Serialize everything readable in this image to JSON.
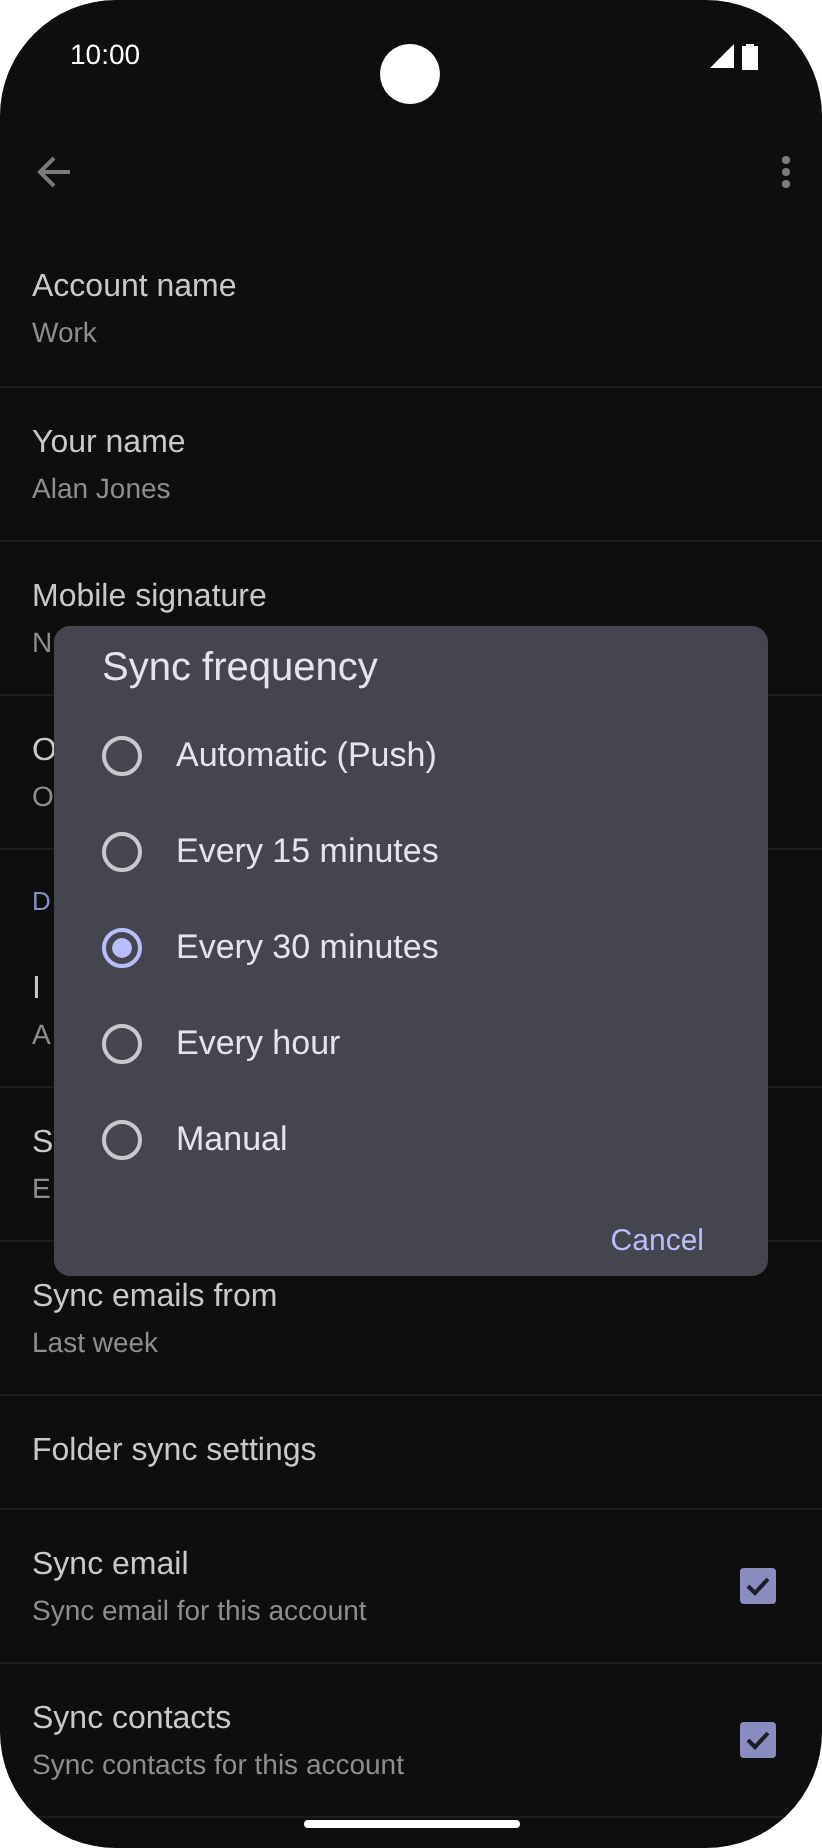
{
  "status_bar": {
    "time": "10:00"
  },
  "rows": [
    {
      "kind": "setting",
      "title": "Account name",
      "subtitle": "Work"
    },
    {
      "kind": "setting",
      "title": "Your name",
      "subtitle": "Alan Jones"
    },
    {
      "kind": "setting",
      "title": "Mobile signature",
      "subtitle": "N"
    },
    {
      "kind": "setting",
      "title": "O",
      "subtitle": "O"
    },
    {
      "kind": "header",
      "title": "D"
    },
    {
      "kind": "setting",
      "title": "I",
      "subtitle": "A"
    },
    {
      "kind": "setting",
      "title": "S",
      "subtitle": "E"
    },
    {
      "kind": "setting",
      "title": "Sync emails from",
      "subtitle": "Last week"
    },
    {
      "kind": "single",
      "title": "Folder sync settings"
    },
    {
      "kind": "checkbox",
      "title": "Sync email",
      "subtitle": "Sync email for this account",
      "checked": true
    },
    {
      "kind": "checkbox",
      "title": "Sync contacts",
      "subtitle": "Sync contacts for this account",
      "checked": true
    }
  ],
  "dialog": {
    "title": "Sync frequency",
    "options": [
      {
        "label": "Automatic (Push)",
        "selected": false
      },
      {
        "label": "Every 15 minutes",
        "selected": false
      },
      {
        "label": "Every 30 minutes",
        "selected": true
      },
      {
        "label": "Every hour",
        "selected": false
      },
      {
        "label": "Manual",
        "selected": false
      }
    ],
    "button": "Cancel"
  }
}
